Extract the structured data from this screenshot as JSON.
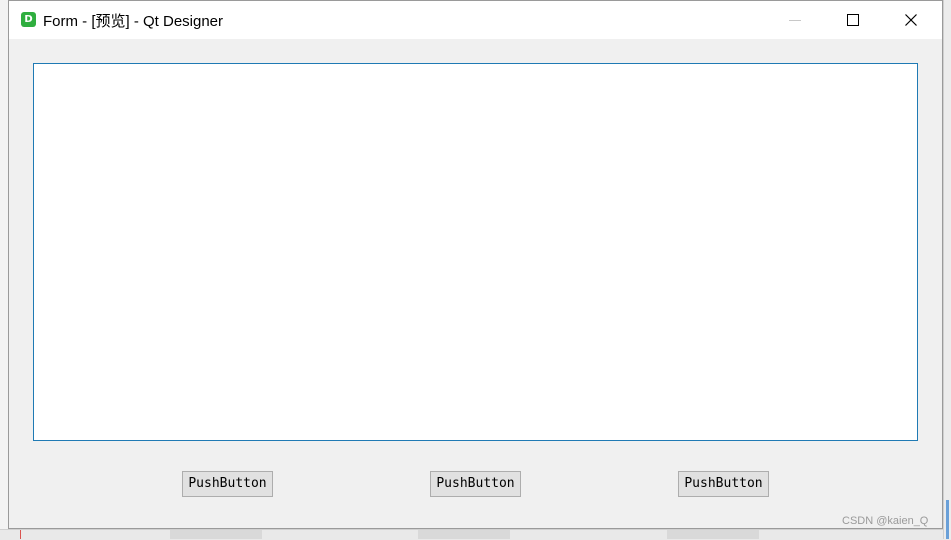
{
  "window": {
    "title": "Form - [预览] - Qt Designer",
    "app_icon_letter": "D",
    "app_icon_color": "#2fae3f",
    "controls": {
      "minimize": "minimize-icon",
      "maximize": "maximize-icon",
      "close": "close-icon"
    }
  },
  "form": {
    "text_area_value": "",
    "text_area_border_color": "#1f7ab4",
    "buttons": [
      {
        "label": "PushButton"
      },
      {
        "label": "PushButton"
      },
      {
        "label": "PushButton"
      }
    ]
  },
  "watermark": "CSDN @kaien_Q"
}
